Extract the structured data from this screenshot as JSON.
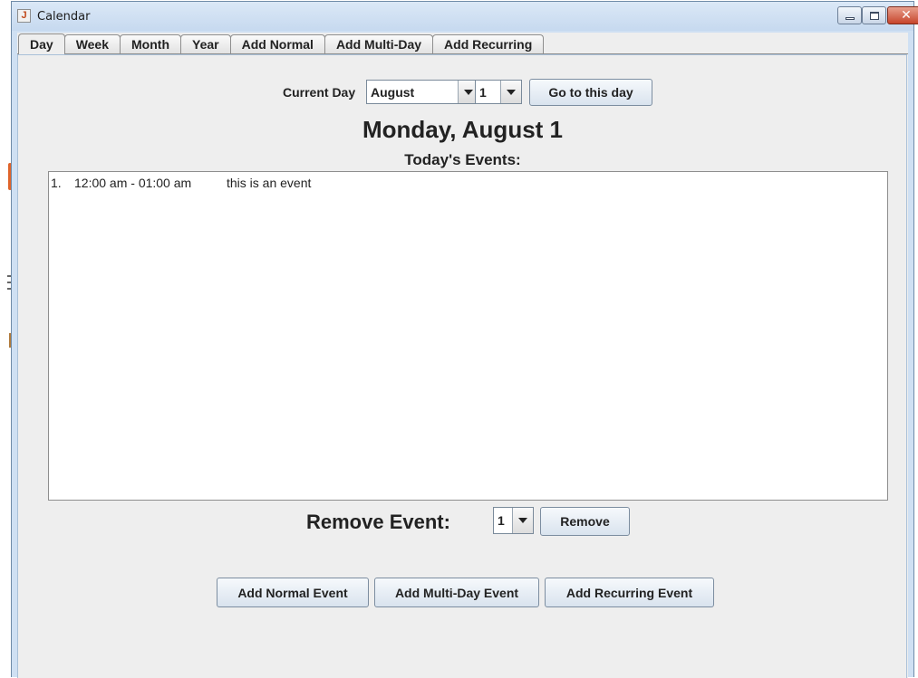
{
  "window": {
    "title": "Calendar",
    "close_glyph": "✕"
  },
  "tabs": [
    "Day",
    "Week",
    "Month",
    "Year",
    "Add Normal",
    "Add Multi-Day",
    "Add Recurring"
  ],
  "day_view": {
    "current_day_label": "Current Day",
    "month_select": "August",
    "day_select": "1",
    "go_button": "Go to this day",
    "date_heading": "Monday, August 1",
    "events_heading": "Today's Events:",
    "events": [
      {
        "num": "1.",
        "time": "12:00 am - 01:00 am",
        "title": "this is an event"
      }
    ],
    "remove_label": "Remove Event:",
    "remove_select": "1",
    "remove_button": "Remove",
    "add_normal_button": "Add Normal Event",
    "add_multiday_button": "Add Multi-Day Event",
    "add_recurring_button": "Add Recurring Event"
  },
  "icons": [
    "java-app-icon",
    "minimize-icon",
    "maximize-icon",
    "close-icon",
    "dropdown-arrow-icon"
  ],
  "colors": {
    "titlebar": "#cfe0f3",
    "client_bg": "#eeeeee",
    "close_button": "#c7452c"
  }
}
